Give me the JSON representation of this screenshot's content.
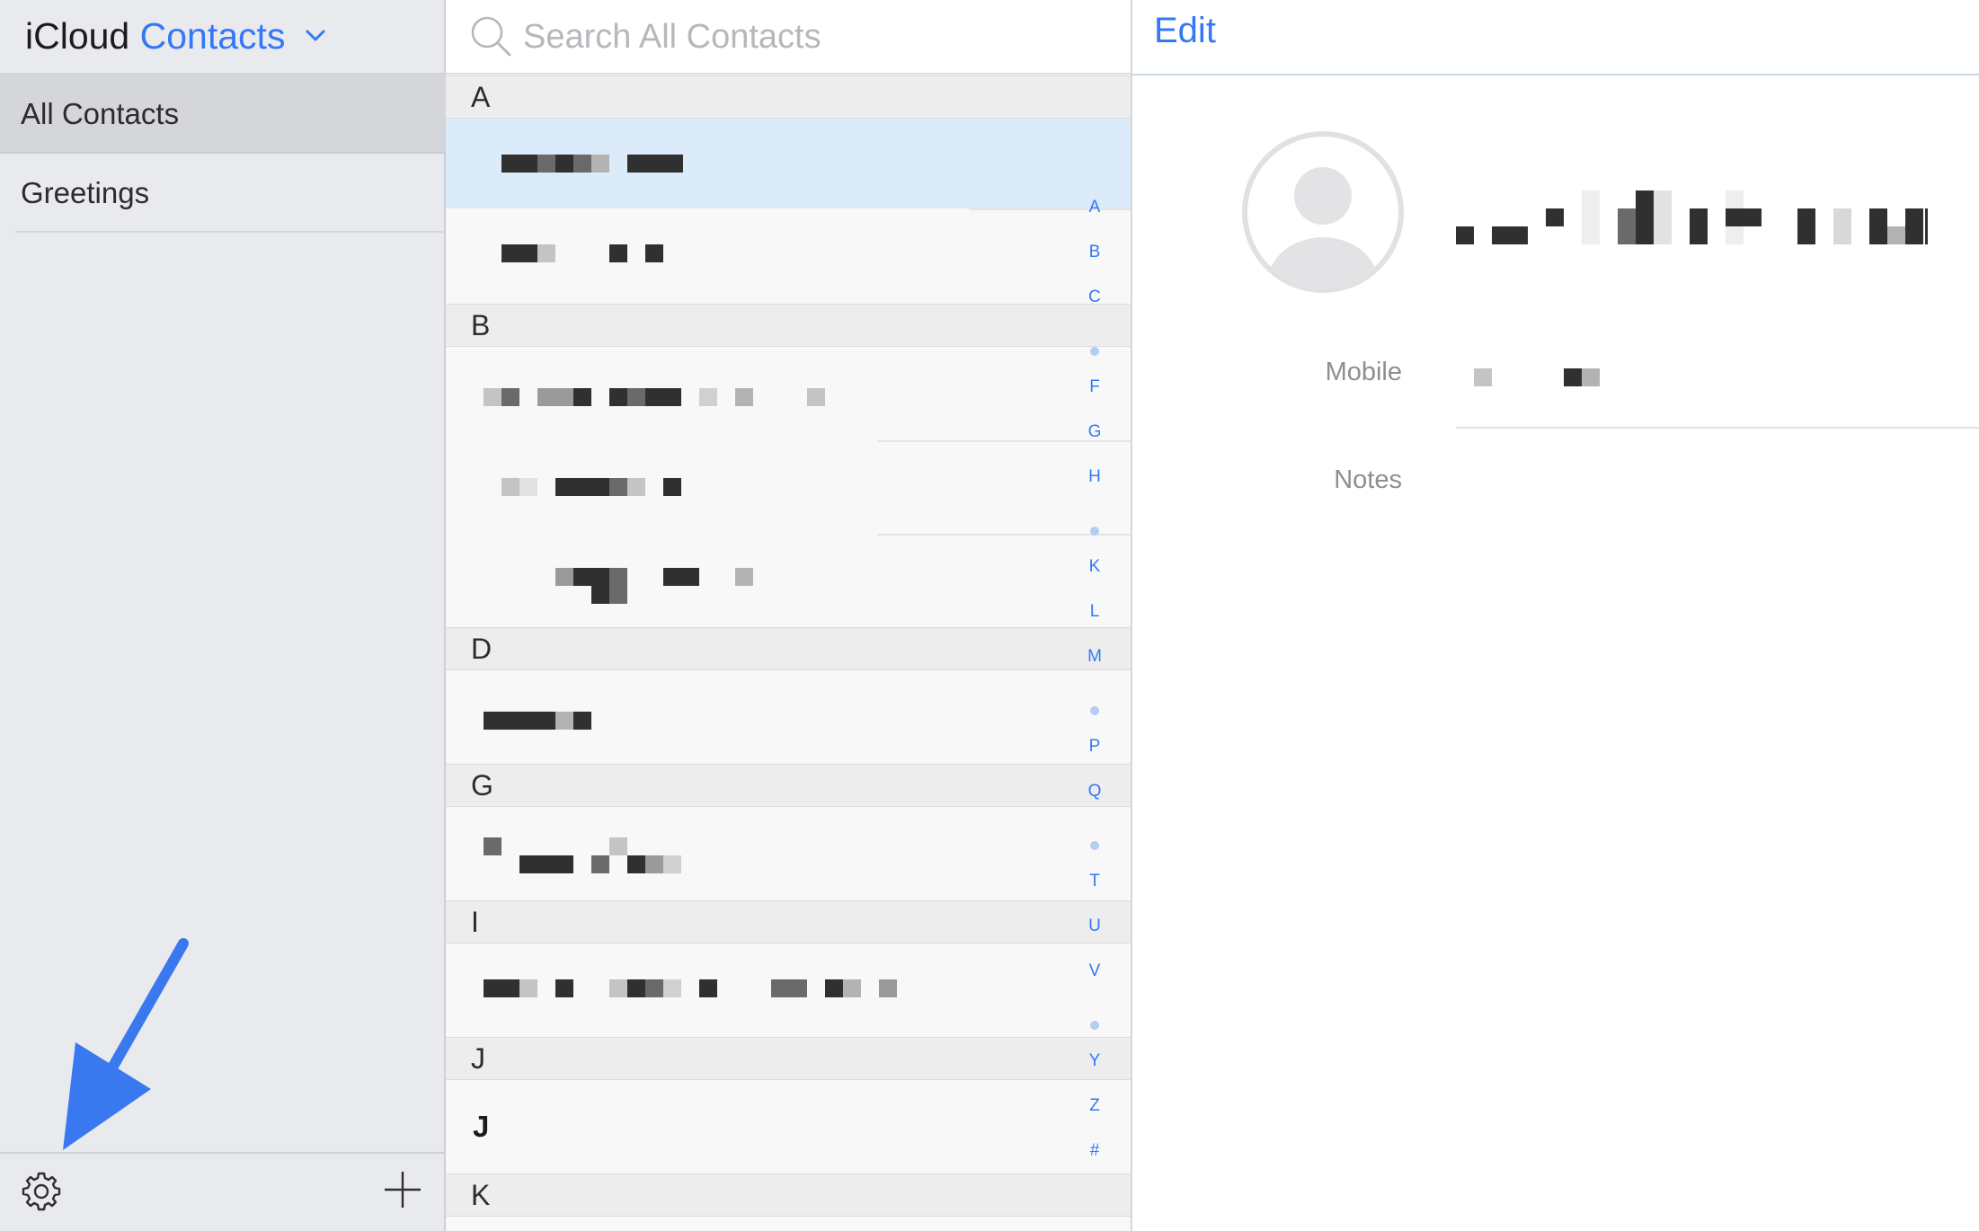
{
  "sidebar": {
    "app_title_brand": "iCloud",
    "app_title_accent": "Contacts",
    "groups": [
      {
        "label": "All Contacts",
        "selected": true
      },
      {
        "label": "Greetings",
        "selected": false
      }
    ],
    "settings_icon": "gear-icon",
    "add_icon": "plus-icon"
  },
  "search": {
    "placeholder": "Search All Contacts"
  },
  "contacts": {
    "sections": [
      "A",
      "B",
      "D",
      "G",
      "I",
      "J",
      "K"
    ],
    "visible_name": "J"
  },
  "index_letters": [
    "A",
    "B",
    "C",
    "F",
    "G",
    "H",
    "K",
    "L",
    "M",
    "P",
    "Q",
    "T",
    "U",
    "V",
    "Y",
    "Z",
    "#"
  ],
  "detail": {
    "edit_label": "Edit",
    "mobile_label": "Mobile",
    "notes_label": "Notes"
  },
  "colors": {
    "accent": "#3478f6",
    "annotation_arrow": "#3a78f0",
    "selected_row": "#dcebfa",
    "sidebar_bg": "#e9eaed"
  }
}
